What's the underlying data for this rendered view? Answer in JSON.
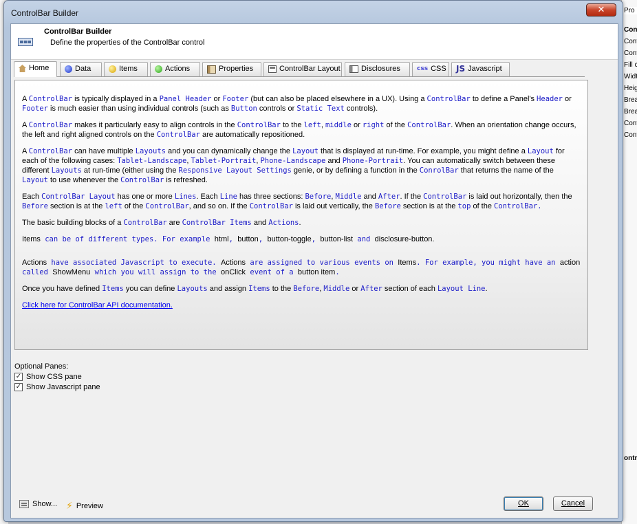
{
  "window": {
    "title": "ControlBar Builder",
    "close_glyph": "✕"
  },
  "header": {
    "title": "ControlBar Builder",
    "subtitle": "Define the properties of the ControlBar control"
  },
  "tabs": [
    {
      "label": "Home",
      "icon": "home-icon"
    },
    {
      "label": "Data",
      "icon": "blue-dot-icon"
    },
    {
      "label": "Items",
      "icon": "yellow-dot-icon"
    },
    {
      "label": "Actions",
      "icon": "green-dot-icon"
    },
    {
      "label": "Properties",
      "icon": "properties-icon"
    },
    {
      "label": "ControlBar Layout",
      "icon": "layout-icon"
    },
    {
      "label": "Disclosures",
      "icon": "disclosures-icon"
    },
    {
      "label": "CSS",
      "icon_text": "css"
    },
    {
      "label": "Javascript",
      "icon_text": "JS"
    }
  ],
  "content": {
    "p1": [
      "A ",
      "ControlBar",
      " is typically displayed in a ",
      "Panel Header",
      " or ",
      "Footer",
      " (but can also be placed elsewhere in a UX). Using a ",
      "ControlBar",
      " to define a Panel's ",
      "Header",
      " or ",
      "Footer",
      " is much easier than using individual controls (such as ",
      "Button",
      " controls or ",
      "Static Text",
      " controls)."
    ],
    "p2": [
      "A ",
      "ControlBar",
      " makes it particularly easy to align controls in the ",
      "ControlBar",
      " to the ",
      "left",
      ", ",
      "middle",
      " or ",
      "right",
      " of the ",
      "ControlBar",
      ". When an orientation change occurs, the left and right aligned controls  on the ",
      "ControlBar",
      " are automatically repositioned."
    ],
    "p3": [
      "A ",
      "ControlBar",
      " can have multiple ",
      "Layouts",
      " and you can dynamically change the ",
      "Layout",
      " that is displayed at run-time. For example, you might define a ",
      "Layout",
      " for each of the following cases: ",
      "Tablet-Landscape",
      ", ",
      "Tablet-Portrait",
      ", ",
      "Phone-Landscape",
      " and ",
      "Phone-Portrait",
      ". You can automatically switch between these different ",
      "Layouts",
      " at run-time (either using the ",
      "Responsive Layout Settings",
      " genie, or by defining a function in the ",
      "ConrolBar",
      " that returns the name of the ",
      "Layout",
      " to use whenever the ",
      "ControlBar",
      " is refreshed."
    ],
    "p4": [
      "Each ",
      "ControlBar Layout",
      " has one or more ",
      "Lines",
      ". Each ",
      "Line",
      " has three sections: ",
      "Before",
      ", ",
      "Middle",
      " and ",
      "After",
      ". If the ",
      "ControlBar",
      " is laid out horizontally, then the ",
      "Before",
      " section is at the ",
      "left",
      " of the ",
      "ControlBar",
      ", and so on. If the ",
      "ControlBar",
      " is laid out vertically, the ",
      "Before",
      " section is at the ",
      "top",
      " of the ",
      "ControlBar."
    ],
    "p5": [
      "The basic building blocks of a ",
      "ControlBar",
      " are ",
      "ControlBar Items",
      " and ",
      "Actions",
      "."
    ],
    "p6": [
      "Items",
      " can be of different types. For example ",
      "html",
      ", ",
      "button",
      ", ",
      "button-toggle",
      ", ",
      "button-list",
      " and ",
      "disclosure-button."
    ],
    "p7": [
      "Actions",
      " have associated Javascript to execute. ",
      "Actions",
      " are assigned to various events on ",
      "Items",
      ". For example, you might have an ",
      "action",
      " called ",
      "ShowMenu",
      " which you will assign to the ",
      "onClick",
      " event of a ",
      "button item",
      "."
    ],
    "p8": [
      "Once you have defined ",
      "Items",
      " you can define ",
      "Layouts",
      " and assign ",
      "Items",
      " to the ",
      "Before",
      ", ",
      "Middle",
      " or ",
      "After",
      " section of each ",
      "Layout Line",
      "."
    ],
    "api_link": "Click here for ControlBar API documentation."
  },
  "optional_panes": {
    "label": "Optional Panes:",
    "show_css": {
      "label": "Show CSS pane",
      "checked": true,
      "glyph": "✓"
    },
    "show_js": {
      "label": "Show Javascript pane",
      "checked": true,
      "glyph": "✓"
    }
  },
  "footer": {
    "show_label": "Show...",
    "preview_label": "Preview",
    "bolt_glyph": "⚡",
    "ok_label": "OK",
    "cancel_label": "Cancel"
  },
  "background": {
    "right_header": "Pro",
    "right_items": [
      "Con",
      "Cont",
      "Cont",
      "Fill c",
      "Widt",
      "Heig",
      "Brea",
      "Brea",
      "Cont",
      "Cont"
    ],
    "right_bottom": "ontr"
  },
  "colors": {
    "code_text": "#1a1ac8",
    "link": "#0000ee",
    "close_button": "#c9452b"
  }
}
